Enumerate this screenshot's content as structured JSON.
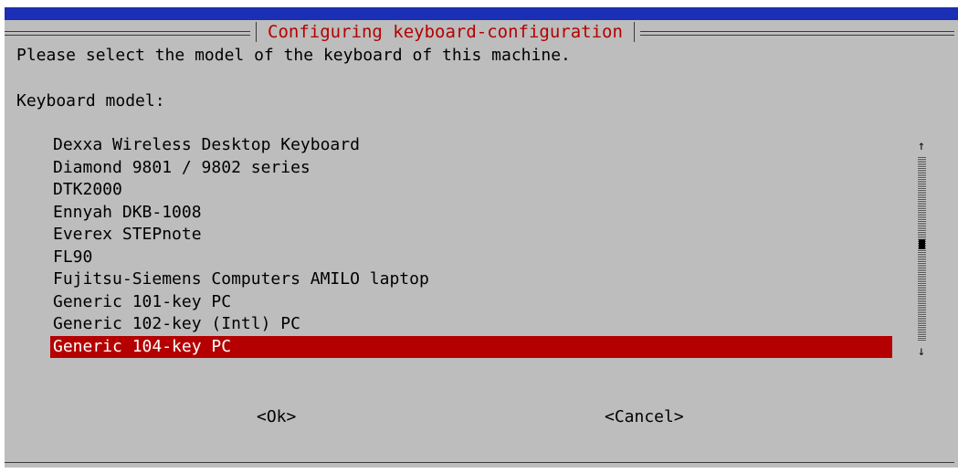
{
  "dialog": {
    "title": "Configuring keyboard-configuration",
    "prompt": "Please select the model of the keyboard of this machine.",
    "field_label": "Keyboard model:"
  },
  "keyboard_models": [
    {
      "label": "Dexxa Wireless Desktop Keyboard",
      "selected": false
    },
    {
      "label": "Diamond 9801 / 9802 series",
      "selected": false
    },
    {
      "label": "DTK2000",
      "selected": false
    },
    {
      "label": "Ennyah DKB-1008",
      "selected": false
    },
    {
      "label": "Everex STEPnote",
      "selected": false
    },
    {
      "label": "FL90",
      "selected": false
    },
    {
      "label": "Fujitsu-Siemens Computers AMILO laptop",
      "selected": false
    },
    {
      "label": "Generic 101-key PC",
      "selected": false
    },
    {
      "label": "Generic 102-key (Intl) PC",
      "selected": false
    },
    {
      "label": "Generic 104-key PC",
      "selected": true
    }
  ],
  "scrollbar": {
    "up_arrow": "↑",
    "down_arrow": "↓"
  },
  "buttons": {
    "ok": "<Ok>",
    "cancel": "<Cancel>"
  },
  "colors": {
    "title_text": "#b40000",
    "selection_bg": "#b40000",
    "dialog_bg": "#bdbdbd",
    "top_bar": "#1a2fb4"
  }
}
